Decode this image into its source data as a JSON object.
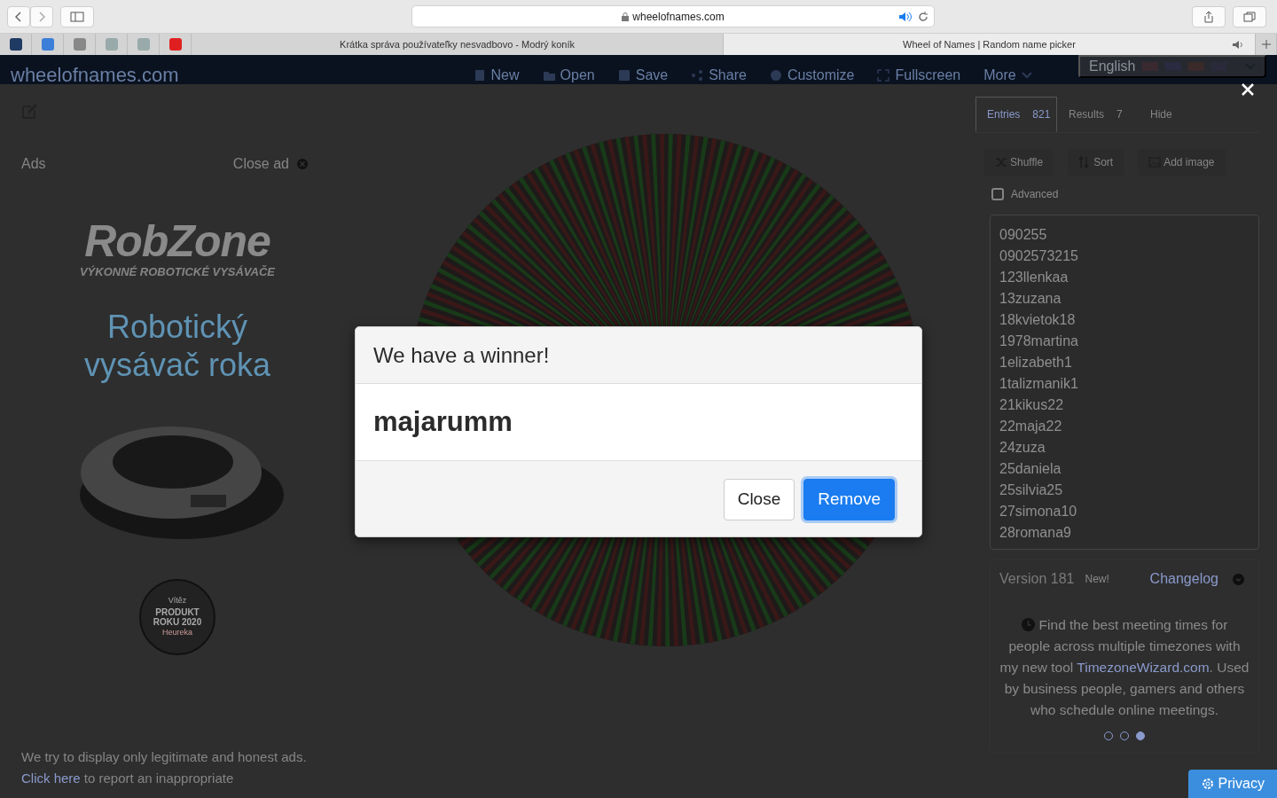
{
  "browser": {
    "url": "wheelofnames.com",
    "tabs": [
      {
        "title": "Krátka správa používateľky nesvadbovo - Modrý koník",
        "selected": false,
        "audio": false
      },
      {
        "title": "Wheel of Names | Random name picker",
        "selected": true,
        "audio": true
      }
    ]
  },
  "nav": {
    "brand": "wheelofnames.com",
    "items": [
      "New",
      "Open",
      "Save",
      "Share",
      "Customize",
      "Fullscreen",
      "More"
    ],
    "language": "English"
  },
  "ad": {
    "label": "Ads",
    "close": "Close ad",
    "logo": "RobZone",
    "tagline": "VÝKONNÉ ROBOTICKÉ VYSÁVAČE",
    "headline": "Robotický vysávač roka",
    "badge": {
      "top": "Vítěz",
      "main": "PRODUKT ROKU 2020",
      "brand": "Heureka"
    },
    "notice_before": "We try to display only legitimate and honest ads. ",
    "notice_link": "Click here",
    "notice_after": " to report an inappropriate"
  },
  "panel": {
    "tabs": [
      {
        "label": "Entries",
        "count": "821",
        "selected": true
      },
      {
        "label": "Results",
        "count": "7",
        "selected": false
      },
      {
        "label": "Hide",
        "selected": false
      }
    ],
    "actions": [
      "Shuffle",
      "Sort",
      "Add image"
    ],
    "advanced": {
      "label": "Advanced",
      "checked": false
    },
    "entries": [
      "090255",
      "0902573215",
      "123llenkaa",
      "13zuzana",
      "18kvietok18",
      "1978martina",
      "1elizabeth1",
      "1talizmanik1",
      "21kikus22",
      "22maja22",
      "24zuza",
      "25daniela",
      "25silvia25",
      "27simona10",
      "28romana9"
    ],
    "news": {
      "version": "Version 181",
      "badge": "New!",
      "link": "Changelog",
      "text_before": "Find the best meeting times for people across multiple timezones with my new tool ",
      "link_text": "TimezoneWizard.com",
      "text_after": ". Used by business people, gamers and others who schedule online meetings.",
      "dots": [
        {
          "selected": false
        },
        {
          "selected": false
        },
        {
          "selected": true
        }
      ]
    }
  },
  "privacy": "Privacy",
  "dialog": {
    "title": "We have a winner!",
    "winner": "majarumm",
    "buttons": [
      {
        "label": "Close",
        "kind": "secondary"
      },
      {
        "label": "Remove",
        "kind": "primary"
      }
    ]
  }
}
